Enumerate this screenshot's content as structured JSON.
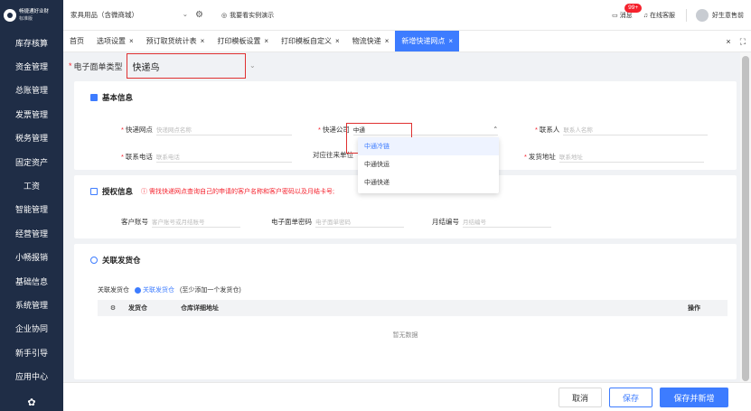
{
  "brand": {
    "name": "畅捷通好业财",
    "edition": "标准版"
  },
  "sidebar": {
    "items": [
      "库存核算",
      "资金管理",
      "总账管理",
      "发票管理",
      "税务管理",
      "固定资产",
      "工资",
      "智能管理",
      "经营管理",
      "小畅报销",
      "基础信息",
      "系统管理",
      "企业协同",
      "新手引导",
      "应用中心"
    ]
  },
  "topbar": {
    "store": "家具用品（含微商城）",
    "demo": "我要看实例演示",
    "messages": "消息",
    "badge": "99+",
    "service": "在线客服",
    "user": "好生意售前"
  },
  "tabs": [
    "首页",
    "选项设置",
    "预订取货统计表",
    "打印模板设置",
    "打印模板自定义",
    "物流快递",
    "新增快递网点"
  ],
  "form": {
    "type_label": "电子面单类型",
    "type_value": "快递鸟",
    "basic": {
      "title": "基本信息",
      "outlet_label": "快递网点",
      "outlet_ph": "快递网点名称",
      "company_label": "快递公司",
      "company_value": "中通",
      "contact_label": "联系人",
      "contact_ph": "联系人名称",
      "phone_label": "联系电话",
      "phone_ph": "联系电话",
      "partner_label": "对应往来单位",
      "address_label": "发货地址",
      "address_ph": "联系地址"
    },
    "dropdown": [
      "中通冷链",
      "中通快运",
      "中通快递"
    ],
    "auth": {
      "title": "授权信息",
      "warning": "需找快递网点查询自己的申请的客户名称和客户密码以及月结卡号;",
      "account_label": "客户账号",
      "account_ph": "客户账号或月结账号",
      "password_label": "电子面单密码",
      "password_ph": "电子面单密码",
      "monthly_label": "月结编号",
      "monthly_ph": "月结编号"
    },
    "warehouse": {
      "title": "关联发货仓",
      "label": "关联发货仓",
      "add": "关联发货仓",
      "hint": "(至少添加一个发货仓)",
      "cols": [
        "发货仓",
        "仓库详细地址",
        "操作"
      ],
      "empty": "暂无数据"
    }
  },
  "footer": {
    "cancel": "取消",
    "save": "保存",
    "save_add": "保存并新增"
  }
}
